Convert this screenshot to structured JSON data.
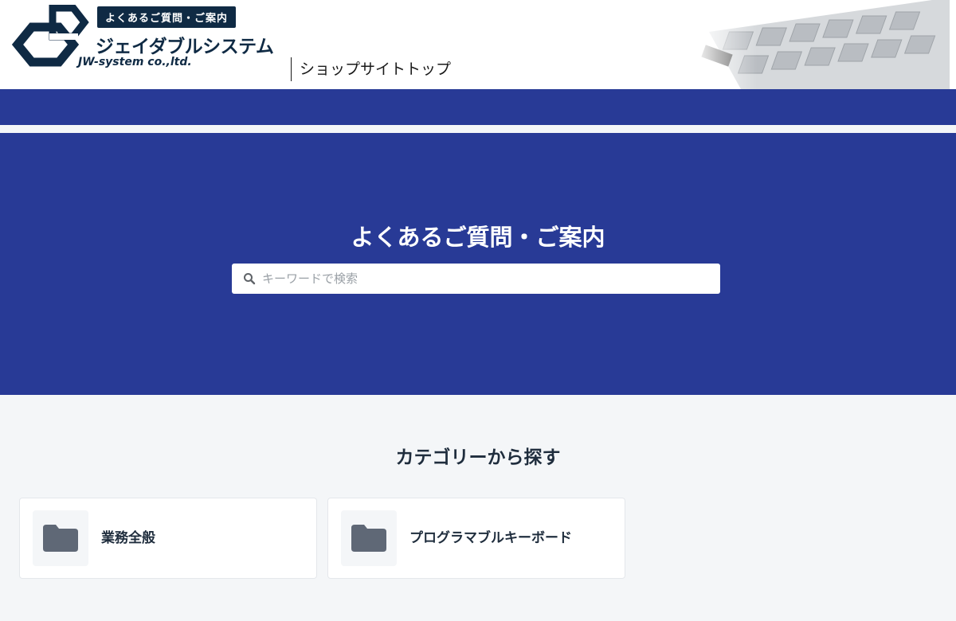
{
  "header": {
    "badge": "よくあるご質問・ご案内",
    "company_name": "ジェイダブルシステム",
    "company_sub": "JW-system co.,ltd.",
    "shop_link": "ショップサイトトップ"
  },
  "hero": {
    "title": "よくあるご質問・ご案内",
    "search_placeholder": "キーワードで検索"
  },
  "categories": {
    "title": "カテゴリーから探す",
    "items": [
      {
        "label": "業務全般",
        "icon": "folder-icon"
      },
      {
        "label": "プログラマブルキーボード",
        "icon": "folder-icon"
      }
    ]
  },
  "colors": {
    "brand_navy": "#0f2a44",
    "hero_blue": "#283a96",
    "page_bg": "#f4f6f8"
  }
}
